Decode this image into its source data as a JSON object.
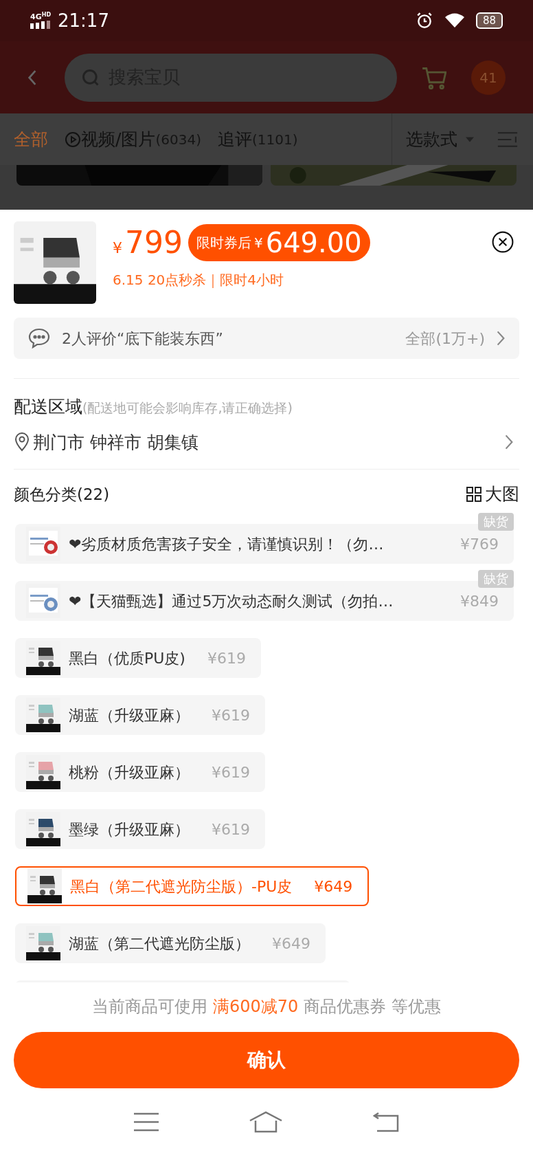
{
  "status_bar": {
    "network": "4G",
    "network_badge": "HD",
    "time": "21:17",
    "battery": "88"
  },
  "header": {
    "search_placeholder": "搜索宝贝",
    "cart_badge": "41"
  },
  "review_tabs": [
    {
      "label": "全部",
      "selected": true
    },
    {
      "label": "视频/图片",
      "count": "(6034)",
      "selected": false,
      "kind": "video"
    },
    {
      "label": "追评",
      "count": "(1101)",
      "selected": false
    }
  ],
  "style_filter": "选款式",
  "product": {
    "price_symbol": "¥",
    "price": "799",
    "coupon_label": "限时券后",
    "coupon_symbol": "¥",
    "coupon_price": "649.00",
    "promo": "6.15 20点秒杀｜限时4小时"
  },
  "review_summary": {
    "text": "2人评价“底下能装东西”",
    "all": "全部(1万+)"
  },
  "delivery": {
    "title": "配送区域",
    "hint": "(配送地可能会影响库存,请正确选择)",
    "location": "荆门市 钟祥市 胡集镇"
  },
  "color_section": {
    "title": "颜色分类(22)",
    "big_image": "大图"
  },
  "options": [
    {
      "label": "❤劣质材质危害孩子安全，请谨慎识别！（勿…",
      "price": "¥769",
      "out_of_stock": true,
      "badge": "缺货",
      "selected": false
    },
    {
      "label": "❤【天猫甄选】通过5万次动态耐久测试（勿拍…",
      "price": "¥849",
      "out_of_stock": true,
      "badge": "缺货",
      "selected": false
    },
    {
      "label": "黑白（优质PU皮)",
      "price": "¥619",
      "out_of_stock": false,
      "selected": false
    },
    {
      "label": "湖蓝（升级亚麻）",
      "price": "¥619",
      "out_of_stock": false,
      "selected": false
    },
    {
      "label": "桃粉（升级亚麻）",
      "price": "¥619",
      "out_of_stock": false,
      "selected": false
    },
    {
      "label": "墨绿（升级亚麻）",
      "price": "¥619",
      "out_of_stock": false,
      "selected": false
    },
    {
      "label": "黑白（第二代遮光防尘版）-PU皮",
      "price": "¥649",
      "out_of_stock": false,
      "selected": true
    },
    {
      "label": "湖蓝（第二代遮光防尘版）",
      "price": "¥649",
      "out_of_stock": false,
      "selected": false
    }
  ],
  "coupon_note": {
    "prefix": "当前商品可使用",
    "highlight": "满600减70",
    "suffix": "商品优惠券 等优惠"
  },
  "confirm_button": "确认"
}
